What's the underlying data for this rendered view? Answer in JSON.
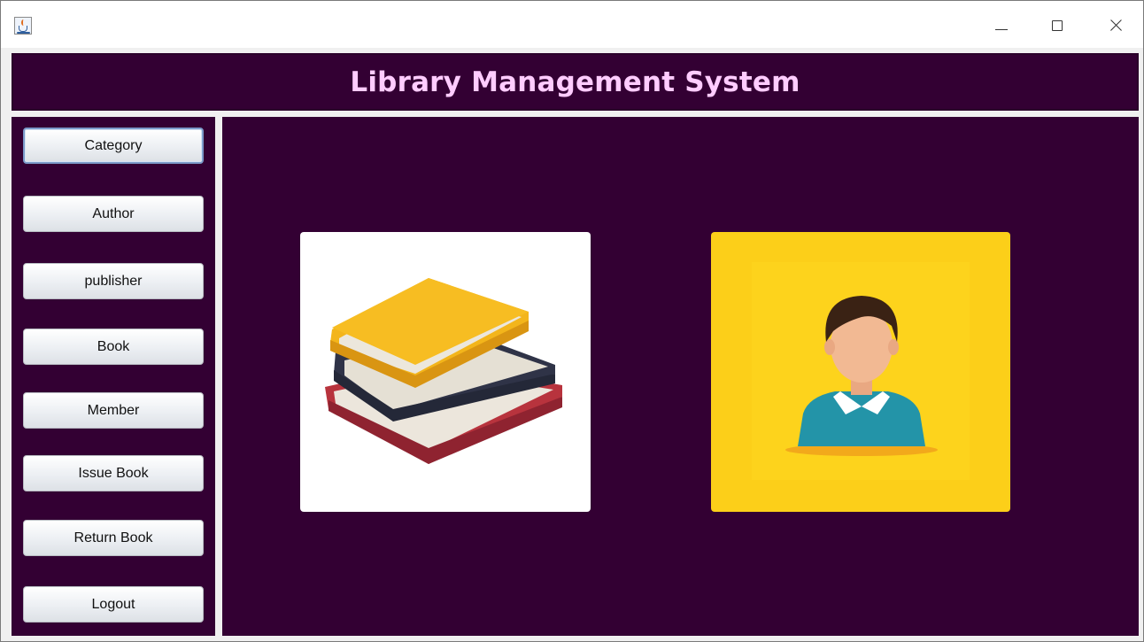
{
  "window": {
    "app_icon": "java-coffee-icon",
    "controls": [
      "minimize-icon",
      "maximize-icon",
      "close-icon"
    ]
  },
  "header": {
    "title": "Library Management System"
  },
  "sidebar": {
    "items": [
      {
        "label": "Category"
      },
      {
        "label": "Author"
      },
      {
        "label": "publisher"
      },
      {
        "label": "Book"
      },
      {
        "label": "Member"
      },
      {
        "label": "Issue Book"
      },
      {
        "label": "Return Book"
      },
      {
        "label": "Logout"
      }
    ]
  },
  "main": {
    "tiles": [
      {
        "icon": "books-icon"
      },
      {
        "icon": "member-icon"
      }
    ]
  },
  "colors": {
    "panel_bg": "#330033",
    "header_text": "#ffccff",
    "member_tile_bg": "#fccf19",
    "books_tile_bg": "#ffffff"
  }
}
